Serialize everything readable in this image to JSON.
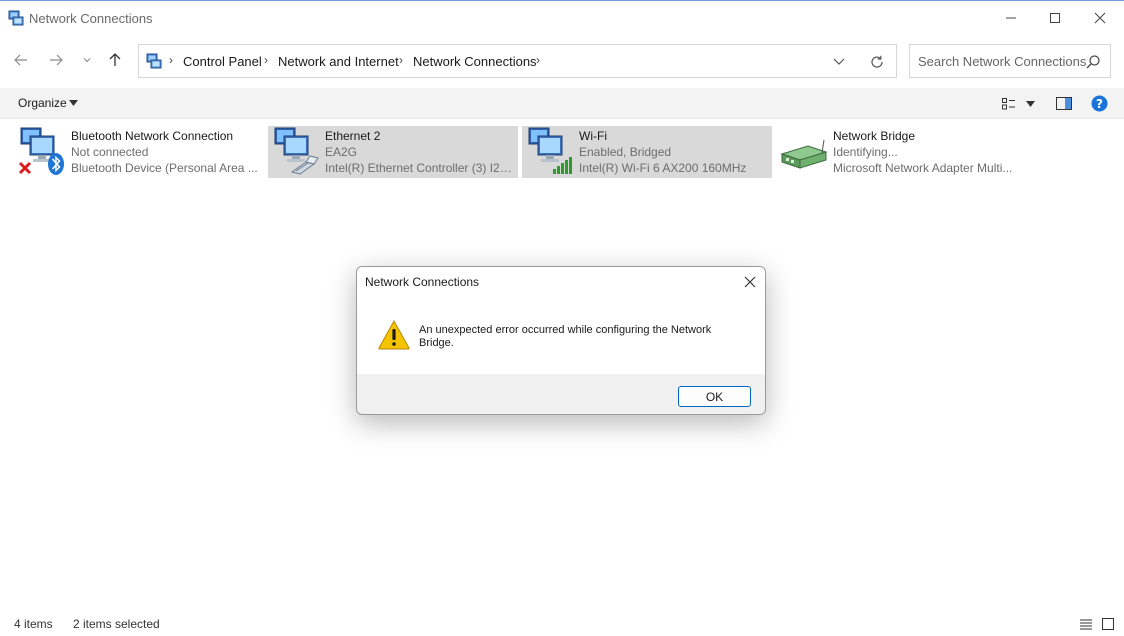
{
  "window": {
    "title": "Network Connections"
  },
  "address": {
    "crumbs": [
      "Control Panel",
      "Network and Internet",
      "Network Connections"
    ]
  },
  "search": {
    "placeholder": "Search Network Connections"
  },
  "toolbar": {
    "organize_label": "Organize"
  },
  "items": [
    {
      "name": "Bluetooth Network Connection",
      "status": "Not connected",
      "device": "Bluetooth Device (Personal Area ...",
      "icon": "bluetooth-adapter-icon",
      "selected": false
    },
    {
      "name": "Ethernet 2",
      "status": "EA2G",
      "device": "Intel(R) Ethernet Controller (3) I22...",
      "icon": "ethernet-adapter-icon",
      "selected": true
    },
    {
      "name": "Wi-Fi",
      "status": "Enabled, Bridged",
      "device": "Intel(R) Wi-Fi 6 AX200 160MHz",
      "icon": "wifi-adapter-icon",
      "selected": true
    },
    {
      "name": "Network Bridge",
      "status": "Identifying...",
      "device": "Microsoft Network Adapter Multi...",
      "icon": "network-bridge-icon",
      "selected": false
    }
  ],
  "statusbar": {
    "count": "4 items",
    "selected": "2 items selected"
  },
  "dialog": {
    "title": "Network Connections",
    "message": "An unexpected error occurred while configuring the Network Bridge.",
    "ok_label": "OK",
    "icon": "warning-icon"
  },
  "colors": {
    "selection": "#d9d9d9",
    "accent": "#0067c0",
    "command_bar": "#f3f3f3"
  }
}
